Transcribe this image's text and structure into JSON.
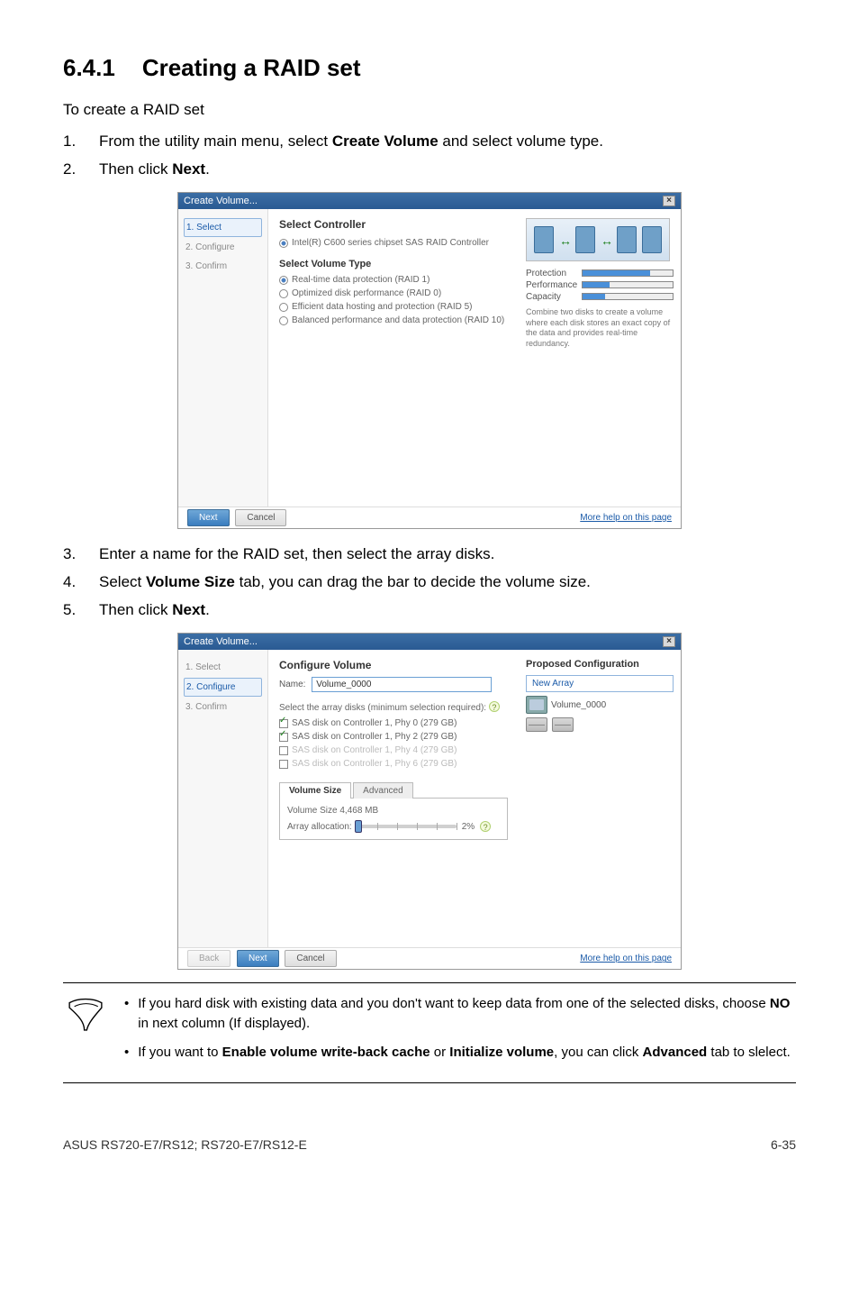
{
  "heading": {
    "number": "6.4.1",
    "title": "Creating a RAID set"
  },
  "intro": "To create a RAID set",
  "steps_a": [
    {
      "n": "1.",
      "pre": "From the utility main menu, select ",
      "bold": "Create Volume",
      "post": " and select volume type."
    },
    {
      "n": "2.",
      "pre": "Then click ",
      "bold": "Next",
      "post": "."
    }
  ],
  "dialog1": {
    "title": "Create Volume...",
    "sidebar": {
      "s1": "1. Select",
      "s2": "2. Configure",
      "s3": "3. Confirm"
    },
    "select_controller_h": "Select Controller",
    "controller_opt": "Intel(R) C600 series chipset SAS RAID Controller",
    "select_volume_h": "Select Volume Type",
    "vt1": "Real-time data protection (RAID 1)",
    "vt2": "Optimized disk performance (RAID 0)",
    "vt3": "Efficient data hosting and protection (RAID 5)",
    "vt4": "Balanced performance and data protection (RAID 10)",
    "meters": {
      "protection": "Protection",
      "performance": "Performance",
      "capacity": "Capacity"
    },
    "note": "Combine two disks to create a volume where each disk stores an exact copy of the data and provides real-time redundancy.",
    "buttons": {
      "next": "Next",
      "cancel": "Cancel"
    },
    "more": "More help on this page"
  },
  "steps_b": [
    {
      "n": "3.",
      "text": "Enter a name for the RAID set, then select the array disks."
    },
    {
      "n": "4.",
      "pre": "Select ",
      "bold": "Volume Size",
      "post": " tab, you can drag the bar to decide the volume size."
    },
    {
      "n": "5.",
      "pre": "Then click ",
      "bold": "Next",
      "post": "."
    }
  ],
  "dialog2": {
    "title": "Create Volume...",
    "sidebar": {
      "s1": "1. Select",
      "s2": "2. Configure",
      "s3": "3. Confirm"
    },
    "configure_h": "Configure Volume",
    "name_label": "Name:",
    "name_value": "Volume_0000",
    "select_disks": "Select the array disks (minimum selection required):",
    "d1": "SAS disk on Controller 1, Phy 0 (279 GB)",
    "d2": "SAS disk on Controller 1, Phy 2 (279 GB)",
    "d3": "SAS disk on Controller 1, Phy 4 (279 GB)",
    "d4": "SAS disk on Controller 1, Phy 6 (279 GB)",
    "tab_volsize": "Volume Size",
    "tab_advanced": "Advanced",
    "volsize_line": "Volume Size 4,468 MB",
    "alloc_label": "Array allocation:",
    "alloc_pct": "2%",
    "proposed_h": "Proposed Configuration",
    "new_array": "New Array",
    "vol_name": "Volume_0000",
    "buttons": {
      "back": "Back",
      "next": "Next",
      "cancel": "Cancel"
    },
    "more": "More help on this page"
  },
  "notes": {
    "n1a": "If you hard disk with existing data and you don't want to keep data from one of the selected disks, choose ",
    "n1b": "NO",
    "n1c": " in next column (If displayed).",
    "n2a": "If you want to ",
    "n2b": "Enable volume write-back cache",
    "n2c": " or ",
    "n2d": "Initialize volume",
    "n2e": ", you can click ",
    "n2f": "Advanced",
    "n2g": " tab to slelect."
  },
  "footer": {
    "left": "ASUS RS720-E7/RS12; RS720-E7/RS12-E",
    "right": "6-35"
  }
}
